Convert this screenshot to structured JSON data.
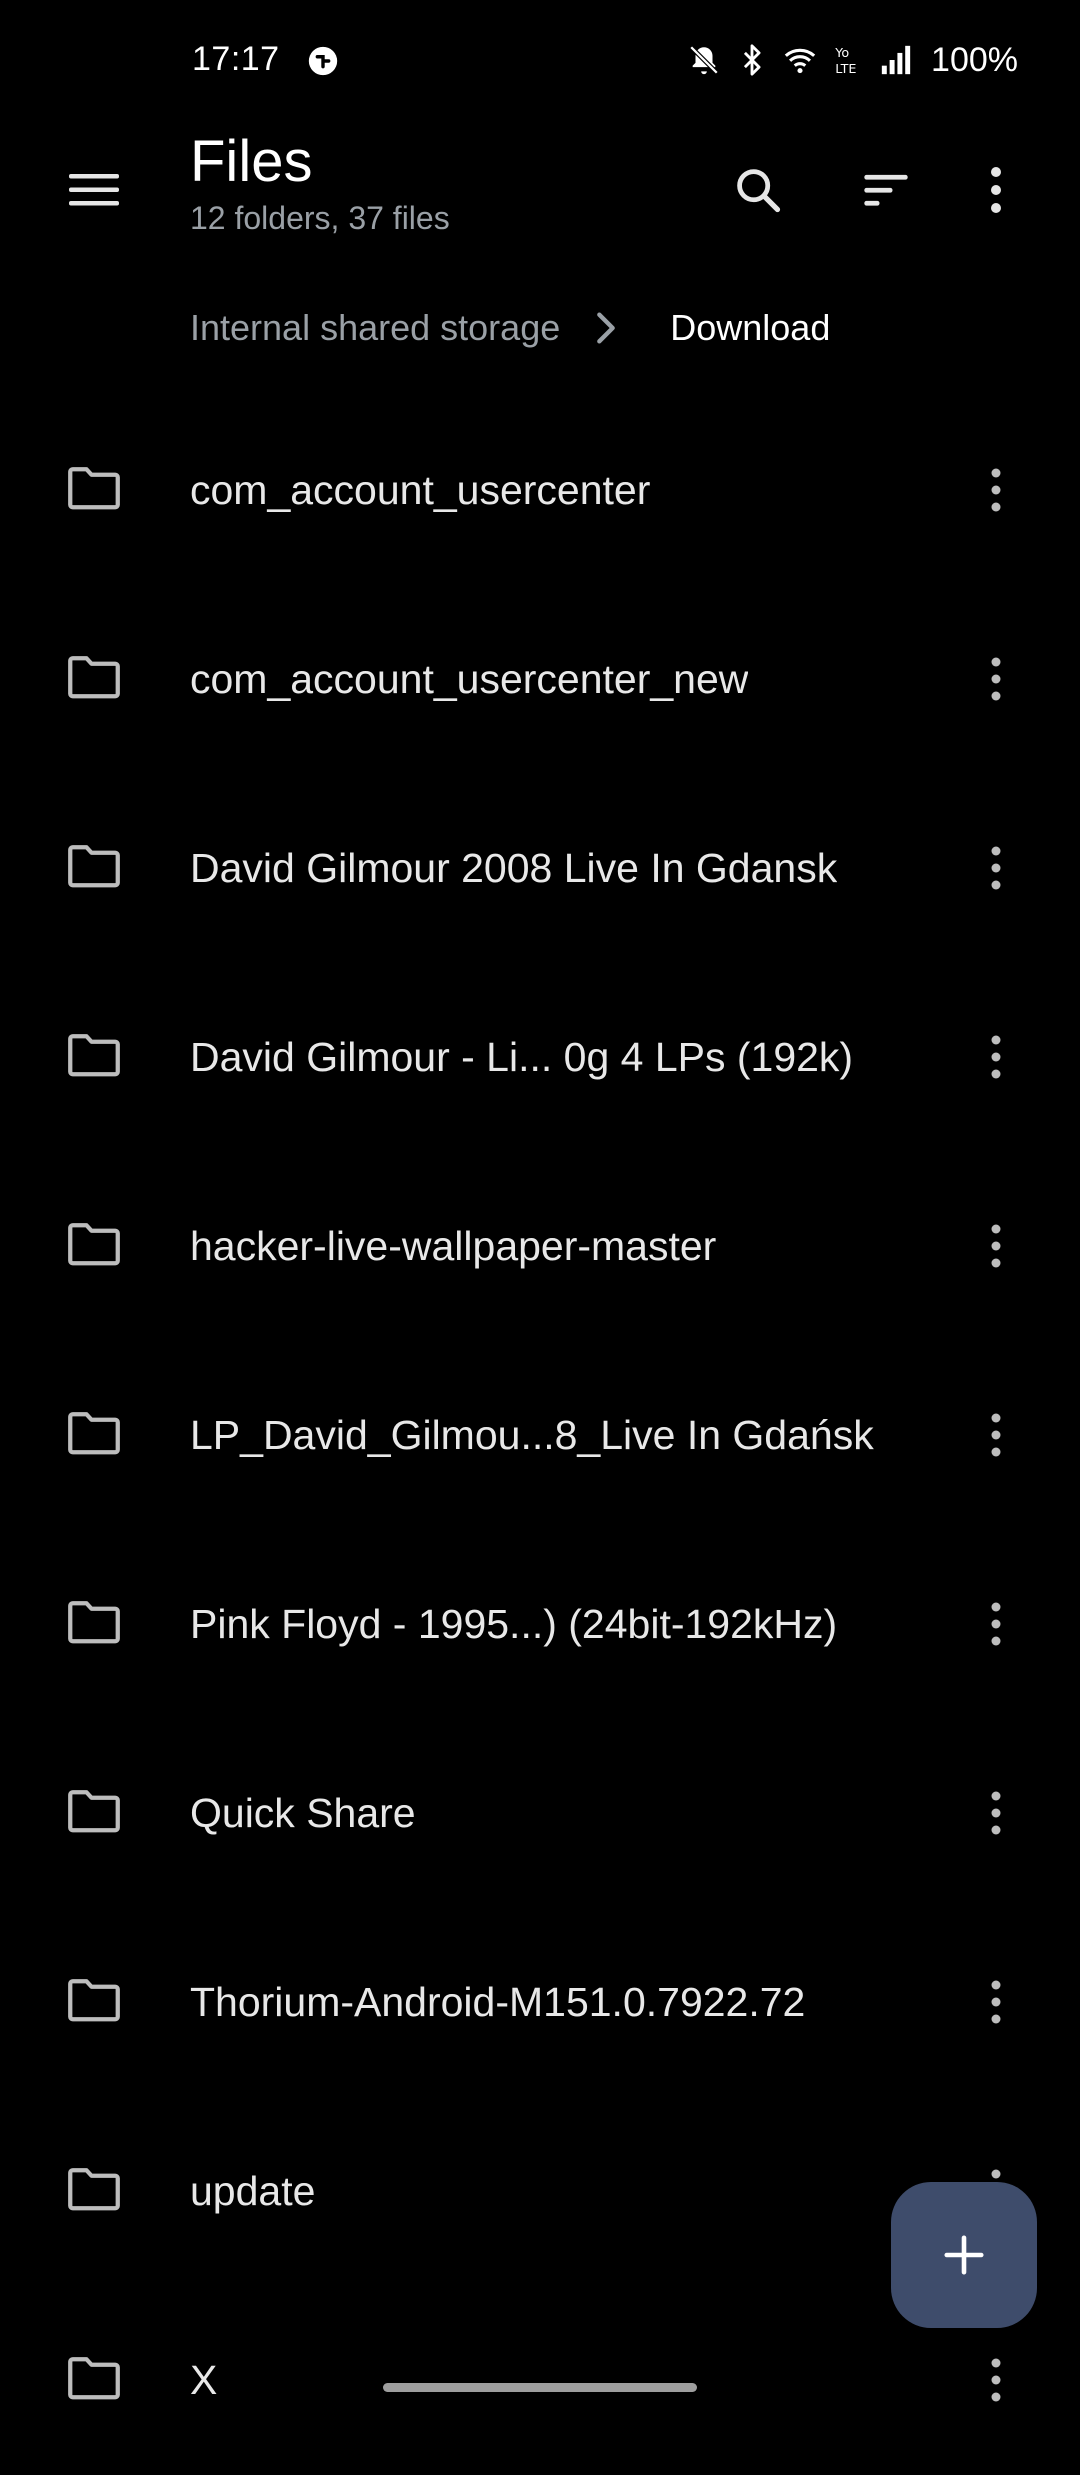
{
  "status_bar": {
    "time": "17:17",
    "battery": "100%",
    "icons": [
      "app-notification-icon",
      "mute-bell-icon",
      "bluetooth-icon",
      "wifi-icon",
      "volte-icon",
      "signal-icon"
    ]
  },
  "app_bar": {
    "title": "Files",
    "subtitle": "12 folders, 37 files",
    "actions": [
      "search-icon",
      "sort-icon",
      "more-vert-icon"
    ]
  },
  "breadcrumb": {
    "root": "Internal shared storage",
    "current": "Download"
  },
  "files": [
    {
      "name": "com_account_usercenter"
    },
    {
      "name": "com_account_usercenter_new"
    },
    {
      "name": "David Gilmour 2008 Live In Gdansk"
    },
    {
      "name": "David Gilmour - Li... 0g 4 LPs (192k)"
    },
    {
      "name": "hacker-live-wallpaper-master"
    },
    {
      "name": "LP_David_Gilmou...8_Live In Gdańsk"
    },
    {
      "name": "Pink Floyd - 1995...) (24bit-192kHz)"
    },
    {
      "name": "Quick Share"
    },
    {
      "name": "Thorium-Android-M151.0.7922.72"
    },
    {
      "name": "update"
    },
    {
      "name": "X"
    }
  ],
  "fab": {
    "icon": "plus-icon"
  },
  "colors": {
    "background": "#000000",
    "fab": "#3e4c6b",
    "secondary_text": "#9aa0a6"
  }
}
